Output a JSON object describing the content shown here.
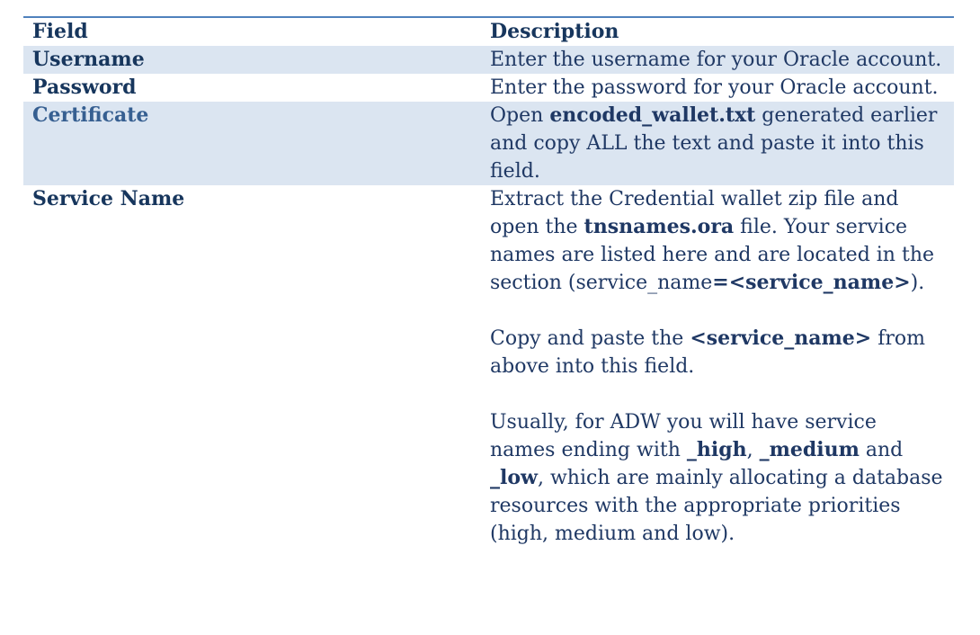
{
  "table": {
    "headers": {
      "field": "Field",
      "description": "Description"
    },
    "rows": [
      {
        "field": "Username",
        "desc": "Enter the username for your Oracle account."
      },
      {
        "field": "Password",
        "desc": "Enter the password for your Oracle account."
      },
      {
        "field": "Certificate",
        "desc_pre": "Open ",
        "desc_bold": "encoded_wallet.txt",
        "desc_post": " generated earlier and copy ALL the text and paste it into this field."
      },
      {
        "field": "Service Name",
        "p1_pre": "Extract the Credential wallet zip file and open the ",
        "p1_bold1": "tnsnames.ora",
        "p1_mid": " file. Your service names are listed here and are located in the section (service_name",
        "p1_bold2": "=<service_name>",
        "p1_post": ").",
        "p2_pre": "Copy and paste the ",
        "p2_bold": "<service_name>",
        "p2_post": " from above into this field.",
        "p3_pre": "Usually, for ADW you will have service names ending with ",
        "p3_bold1": "_high",
        "p3_sep1": ", ",
        "p3_bold2": "_medium",
        "p3_sep2": " and ",
        "p3_bold3": "_low",
        "p3_post": ", which are mainly allocating a database resources with the appropriate priorities (high, medium and low)."
      }
    ]
  },
  "colors": {
    "border": "#4f81bd",
    "shade": "#dbe5f1",
    "text": "#17365d"
  }
}
